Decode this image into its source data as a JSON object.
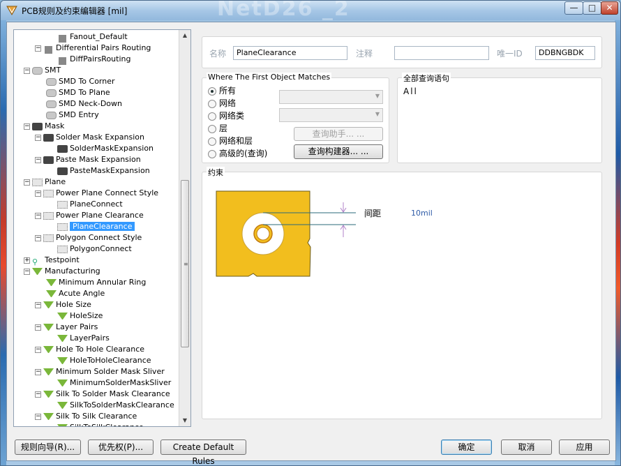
{
  "window": {
    "title": "PCB规则及约束编辑器 [mil]",
    "ghost_title": "NetD26 _2",
    "min_glyph": "—",
    "max_glyph": "□",
    "close_glyph": "✕"
  },
  "tree": {
    "items": [
      {
        "label": "Fanout_Default",
        "icon": "route-icon"
      },
      {
        "label": "Differential Pairs Routing",
        "icon": "route-icon",
        "expander": "−"
      },
      {
        "label": "DiffPairsRouting",
        "icon": "route-icon"
      },
      {
        "label": "SMT",
        "icon": "smt-icon",
        "expander": "−"
      },
      {
        "label": "SMD To Corner",
        "icon": "smt-icon"
      },
      {
        "label": "SMD To Plane",
        "icon": "smt-icon"
      },
      {
        "label": "SMD Neck-Down",
        "icon": "smt-icon"
      },
      {
        "label": "SMD Entry",
        "icon": "smt-icon"
      },
      {
        "label": "Mask",
        "icon": "mask-icon",
        "expander": "−"
      },
      {
        "label": "Solder Mask Expansion",
        "icon": "mask-icon",
        "expander": "−"
      },
      {
        "label": "SolderMaskExpansion",
        "icon": "mask-icon"
      },
      {
        "label": "Paste Mask Expansion",
        "icon": "mask-icon",
        "expander": "−"
      },
      {
        "label": "PasteMaskExpansion",
        "icon": "mask-icon"
      },
      {
        "label": "Plane",
        "icon": "plane-icon",
        "expander": "−"
      },
      {
        "label": "Power Plane Connect Style",
        "icon": "plane-icon",
        "expander": "−"
      },
      {
        "label": "PlaneConnect",
        "icon": "plane-icon"
      },
      {
        "label": "Power Plane Clearance",
        "icon": "plane-icon",
        "expander": "−"
      },
      {
        "label": "PlaneClearance",
        "icon": "plane-icon",
        "selected": true
      },
      {
        "label": "Polygon Connect Style",
        "icon": "plane-icon",
        "expander": "−"
      },
      {
        "label": "PolygonConnect",
        "icon": "plane-icon"
      },
      {
        "label": "Testpoint",
        "icon": "testpoint-icon",
        "expander": "+"
      },
      {
        "label": "Manufacturing",
        "icon": "manufacturing-icon",
        "expander": "−"
      },
      {
        "label": "Minimum Annular Ring",
        "icon": "manufacturing-icon"
      },
      {
        "label": "Acute Angle",
        "icon": "manufacturing-icon"
      },
      {
        "label": "Hole Size",
        "icon": "manufacturing-icon",
        "expander": "−"
      },
      {
        "label": "HoleSize",
        "icon": "manufacturing-icon"
      },
      {
        "label": "Layer Pairs",
        "icon": "manufacturing-icon",
        "expander": "−"
      },
      {
        "label": "LayerPairs",
        "icon": "manufacturing-icon"
      },
      {
        "label": "Hole To Hole Clearance",
        "icon": "manufacturing-icon",
        "expander": "−"
      },
      {
        "label": "HoleToHoleClearance",
        "icon": "manufacturing-icon"
      },
      {
        "label": "Minimum Solder Mask Sliver",
        "icon": "manufacturing-icon",
        "expander": "−"
      },
      {
        "label": "MinimumSolderMaskSliver",
        "icon": "manufacturing-icon"
      },
      {
        "label": "Silk To Solder Mask Clearance",
        "icon": "manufacturing-icon",
        "expander": "−"
      },
      {
        "label": "SilkToSolderMaskClearance",
        "icon": "manufacturing-icon"
      },
      {
        "label": "Silk To Silk Clearance",
        "icon": "manufacturing-icon",
        "expander": "−"
      },
      {
        "label": "SilkToSilkClearance",
        "icon": "manufacturing-icon"
      }
    ]
  },
  "rule": {
    "name_label": "名称",
    "name_value": "PlaneClearance",
    "comment_label": "注释",
    "comment_value": "",
    "uid_label": "唯一ID",
    "uid_value": "DDBNGBDK"
  },
  "match": {
    "title": "Where The First Object Matches",
    "options": [
      "所有",
      "网络",
      "网络类",
      "层",
      "网络和层",
      "高级的(查询)"
    ],
    "selected": "所有",
    "helper_button": "查询助手... ...",
    "builder_button": "查询构建器... ..."
  },
  "query": {
    "title": "全部查询语句",
    "text": "All"
  },
  "constraint": {
    "title": "约束",
    "clearance_label": "间距",
    "clearance_value": "10mil",
    "plane_color": "#f2be1e"
  },
  "footer": {
    "wizard_button": "规则向导(R)...",
    "priority_button": "优先权(P)...",
    "default_rules_button": "Create Default Rules",
    "ok_button": "确定",
    "cancel_button": "取消",
    "apply_button": "应用"
  }
}
